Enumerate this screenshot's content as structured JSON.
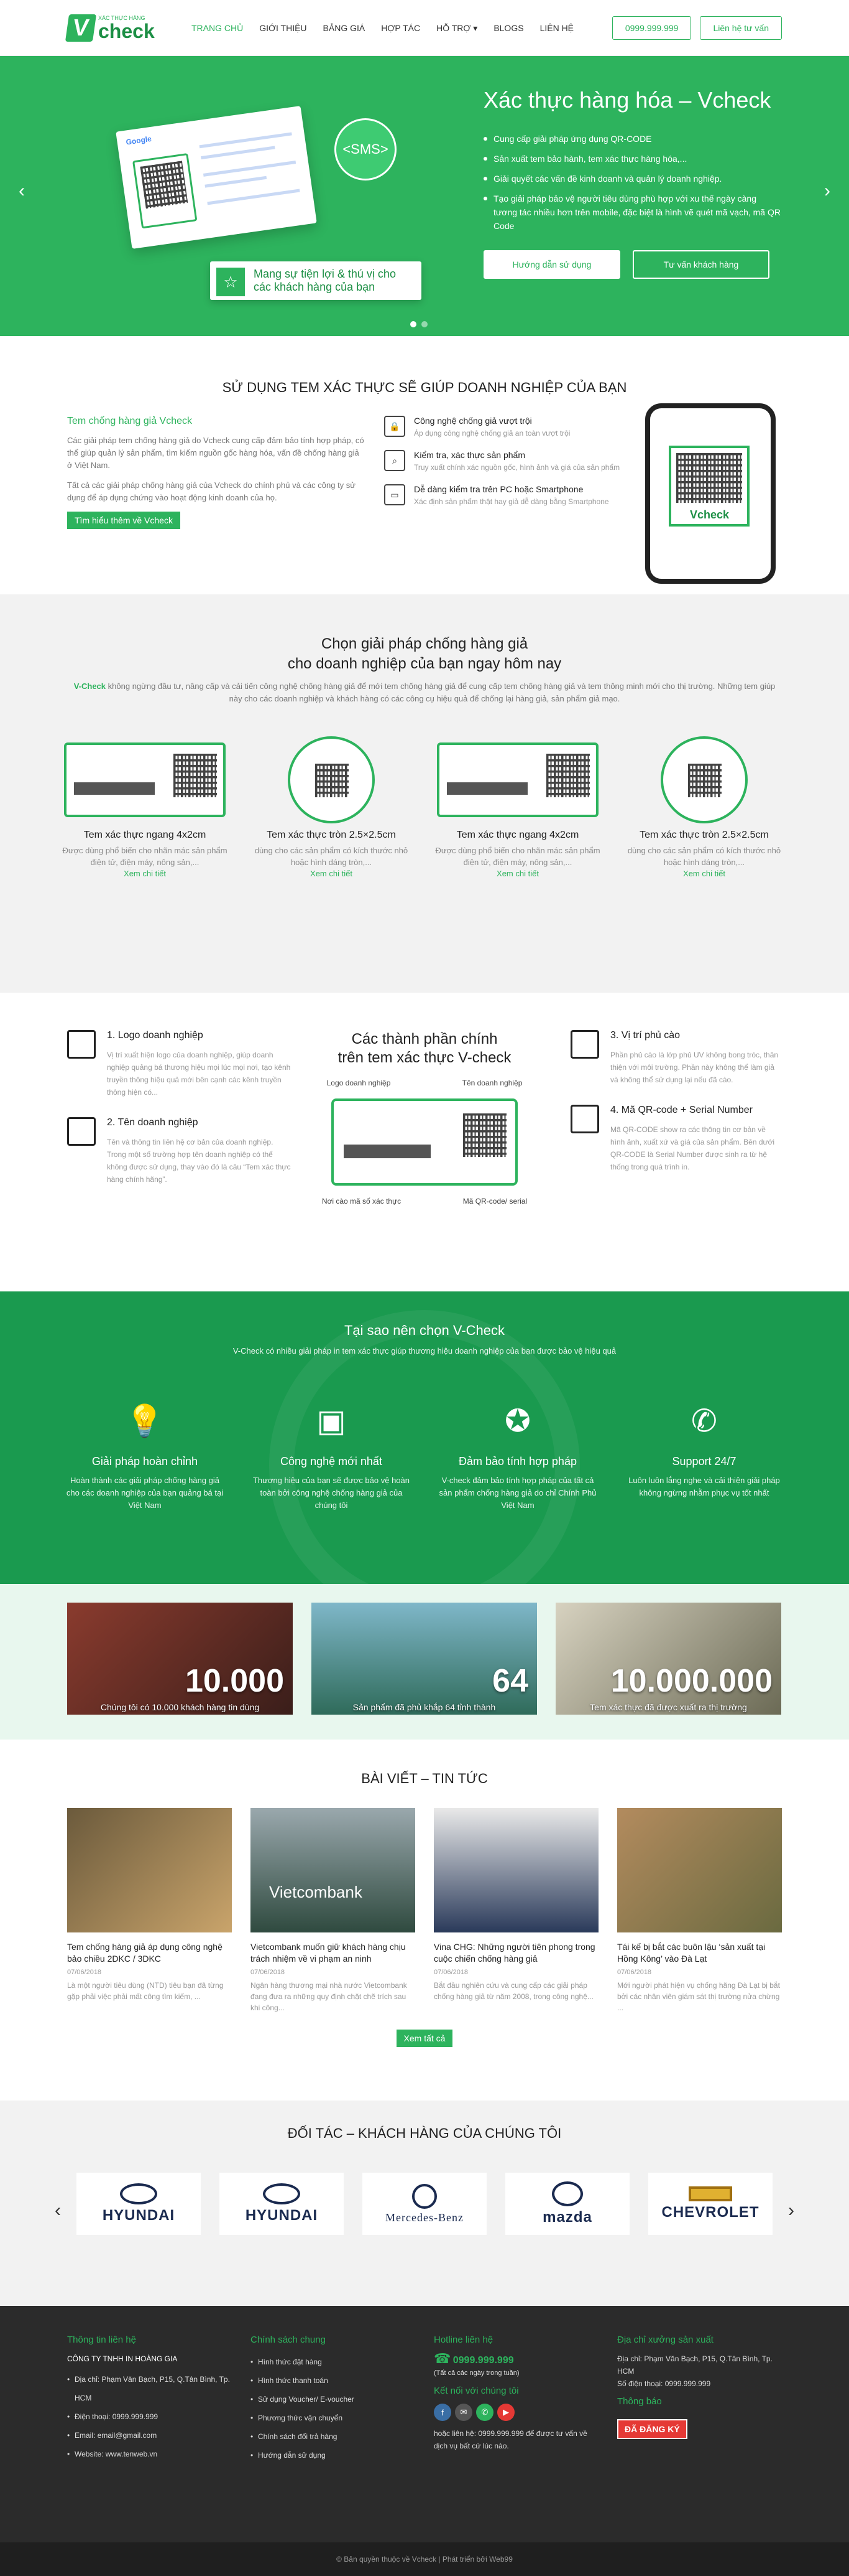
{
  "header": {
    "logo_small": "XÁC THỰC HÀNG",
    "logo_brand": "check",
    "logo_v": "V",
    "nav": [
      "TRANG CHỦ",
      "GIỚI THIỆU",
      "BẢNG GIÁ",
      "HỢP TÁC",
      "HỖ TRỢ",
      "BLOGS",
      "LIÊN HỆ"
    ],
    "phone": "0999.999.999",
    "consult": "Liên hệ tư vấn"
  },
  "hero": {
    "title": "Xác thực hàng hóa – Vcheck",
    "sms": "<SMS>",
    "google": "Google",
    "slogan": "Mang sự tiện lợi & thú vị cho các khách hàng của bạn",
    "bullets": [
      "Cung cấp giải pháp ứng dụng QR-CODE",
      "Sản xuất tem bảo hành, tem xác thực hàng hóa,...",
      "Giải quyết các vấn đề kinh doanh và quản lý doanh nghiệp.",
      "Tạo giải pháp bảo vệ người tiêu dùng phù hợp với xu thế ngày càng tương tác nhiều hơn trên mobile, đặc biệt là hình vẽ quét mã vạch, mã QR Code"
    ],
    "btn1": "Hướng dẫn sử dụng",
    "btn2": "Tư vấn khách hàng"
  },
  "benefits": {
    "title": "SỬ DỤNG TEM XÁC THỰC SẼ GIÚP DOANH NGHIỆP CỦA BẠN",
    "left_title": "Tem chống hàng giả Vcheck",
    "p1": "Các giải pháp tem chống hàng giả do Vcheck cung cấp đảm bảo tính hợp pháp, có thể giúp quản lý sản phẩm, tìm kiếm nguồn gốc hàng hóa, vấn đề chống hàng giả ở Việt Nam.",
    "p2": "Tất cả các giải pháp chống hàng giả của Vcheck do chính phủ và các công ty sử dụng để áp dụng chứng vào hoạt động kinh doanh của họ.",
    "btn": "Tìm hiểu thêm về Vcheck",
    "features": [
      {
        "t": "Công nghệ chống giả vượt trội",
        "d": "Áp dụng công nghệ chống giả an toàn vượt trội"
      },
      {
        "t": "Kiểm tra, xác thực sản phẩm",
        "d": "Truy xuất chính xác nguồn gốc, hình ảnh và giá của sản phẩm"
      },
      {
        "t": "Dễ dàng kiểm tra trên PC hoặc Smartphone",
        "d": "Xác định sản phẩm thật hay giả dễ dàng bằng Smartphone"
      }
    ],
    "phone_brand": "Vcheck"
  },
  "solutions": {
    "title1": "Chọn giải pháp chống hàng giả",
    "title2": "cho doanh nghiệp của bạn ngay hôm nay",
    "brand": "V-Check",
    "desc": "không ngừng đầu tư, nâng cấp và cải tiến công nghệ chống hàng giả để mới tem chống hàng giả để cung cấp tem chống hàng giả và tem thông minh mới cho thị trường. Những tem giúp này cho các doanh nghiệp và khách hàng có các công cụ hiệu quả để chống lại hàng giả, sản phẩm giả mạo.",
    "items": [
      {
        "t": "Tem xác thực ngang 4x2cm",
        "d": "Được dùng phổ biến cho nhãn mác sản phẩm điện tử, điện máy, nông sản,..."
      },
      {
        "t": "Tem xác thực tròn 2.5×2.5cm",
        "d": "dùng cho các sản phẩm có kích thước nhỏ hoặc hình dáng tròn,..."
      },
      {
        "t": "Tem xác thực ngang 4x2cm",
        "d": "Được dùng phổ biến cho nhãn mác sản phẩm điện tử, điện máy, nông sản,..."
      },
      {
        "t": "Tem xác thực tròn 2.5×2.5cm",
        "d": "dùng cho các sản phẩm có kích thước nhỏ hoặc hình dáng tròn,..."
      }
    ],
    "more": "Xem chi tiết"
  },
  "components": {
    "title1": "Các thành phần chính",
    "title2": "trên tem xác thực V-check",
    "tags": [
      "Logo doanh nghiệp",
      "Tên doanh nghiệp",
      "Nơi cào mã số xác thực",
      "Mã QR-code/ serial"
    ],
    "items": [
      {
        "t": "1. Logo doanh nghiệp",
        "d": "Vị trí xuất hiện logo của doanh nghiệp, giúp doanh nghiệp quảng bá thương hiệu mọi lúc mọi nơi, tạo kênh truyền thông hiệu quả mới bên cạnh các kênh truyền thông hiện có..."
      },
      {
        "t": "2. Tên doanh nghiệp",
        "d": "Tên và thông tin liên hệ cơ bản của doanh nghiệp. Trong một số trường hợp tên doanh nghiệp có thể không được sử dụng, thay vào đó là câu “Tem xác thực hàng chính hãng”."
      },
      {
        "t": "3. Vị trí phủ cào",
        "d": "Phần phủ cào là lớp phủ UV không bong tróc, thân thiện với môi trường. Phần này không thể làm giả và không thể sử dụng lại nếu đã cào."
      },
      {
        "t": "4. Mã QR-code + Serial Number",
        "d": "Mã QR-CODE show ra các thông tin cơ bản về hình ảnh, xuất xứ và giá của sản phẩm. Bên dưới QR-CODE là Serial Number được sinh ra từ hệ thống trong quá trình in."
      }
    ]
  },
  "why": {
    "title": "Tại sao nên chọn V-Check",
    "desc": "V-Check có nhiều giải pháp in tem xác thực giúp thương hiệu doanh nghiệp của bạn được bảo vệ hiệu quả",
    "items": [
      {
        "t": "Giải pháp hoàn chỉnh",
        "d": "Hoàn thành các giải pháp chống hàng giả cho các doanh nghiệp của bạn quảng bá tại Việt Nam"
      },
      {
        "t": "Công nghệ mới nhất",
        "d": "Thương hiệu của bạn sẽ được bảo vệ hoàn toàn bởi công nghệ chống hàng giả của chúng tôi"
      },
      {
        "t": "Đảm bảo tính hợp pháp",
        "d": "V-check đảm bảo tính hợp pháp của tất cả sản phẩm chống hàng giả do chỉ Chính Phủ Việt Nam"
      },
      {
        "t": "Support 24/7",
        "d": "Luôn luôn lắng nghe và cải thiện giải pháp không ngừng nhằm phục vụ tốt nhất"
      }
    ]
  },
  "stats": [
    {
      "n": "10.000",
      "t": "Chúng tôi có 10.000 khách hàng tin dùng"
    },
    {
      "n": "64",
      "t": "Sản phẩm đã phủ khắp 64 tỉnh thành"
    },
    {
      "n": "10.000.000",
      "t": "Tem xác thực đã được xuất ra thị trường"
    }
  ],
  "news": {
    "title": "BÀI VIẾT – TIN TỨC",
    "more": "Xem tất cả",
    "items": [
      {
        "t": "Tem chống hàng giả áp dụng công nghệ bảo chiều 2DKC / 3DKC",
        "dt": "07/06/2018",
        "d": "Là một người tiêu dùng (NTD) tiêu bạn đã từng gặp phải việc phải mất công tìm kiếm, ..."
      },
      {
        "t": "Vietcombank muốn giữ khách hàng chịu trách nhiệm về vi phạm an ninh",
        "dt": "07/06/2018",
        "d": "Ngân hàng thương mại nhà nước Vietcombank đang đưa ra những quy định chặt chẽ trích sau khi công..."
      },
      {
        "t": "Vina CHG: Những người tiên phong trong cuộc chiến chống hàng giả",
        "dt": "07/06/2018",
        "d": "Bắt đầu nghiên cứu và cung cấp các giải pháp chống hàng giả từ năm 2008, trong công nghệ..."
      },
      {
        "t": "Tái kế bị bắt các buôn lậu ‘sản xuất tại Hồng Kông’ vào Đà Lạt",
        "dt": "07/06/2018",
        "d": "Mới người phát hiện vụ chống hãng Đà Lạt bị bắt bởi các nhân viên giám sát thị trường nửa chừng ..."
      }
    ],
    "bank": "Vietcombank"
  },
  "partners": {
    "title": "ĐỐI TÁC – KHÁCH HÀNG CỦA CHÚNG TÔI",
    "logos": [
      "HYUNDAI",
      "HYUNDAI",
      "Mercedes-Benz",
      "mazda",
      "CHEVROLET"
    ]
  },
  "footer": {
    "c1_title": "Thông tin liên hệ",
    "company": "CÔNG TY TNHH IN HOÀNG GIA",
    "c1": [
      "Địa chỉ: Phạm Văn Bạch, P15, Q.Tân Bình, Tp. HCM",
      "Điện thoại: 0999.999.999",
      "Email: email@gmail.com",
      "Website: www.tenweb.vn"
    ],
    "c2_title": "Chính sách chung",
    "c2": [
      "Hình thức đặt hàng",
      "Hình thức thanh toán",
      "Sử dụng Voucher/ E-voucher",
      "Phương thức vận chuyển",
      "Chính sách đổi trả hàng",
      "Hướng dẫn sử dụng"
    ],
    "c3_title": "Hotline liên hệ",
    "hotline": "0999.999.999",
    "hotline_note": "(Tất cả các ngày trong tuần)",
    "social_title": "Kết nối với chúng tôi",
    "social": [
      "f",
      "✉",
      "✆",
      "▶"
    ],
    "c3_note": "hoặc liên hệ: 0999.999.999 để được tư vấn về dịch vụ bất cứ lúc nào.",
    "c4_title": "Địa chỉ xưởng sản xuất",
    "c4": [
      "Địa chỉ: Phạm Văn Bạch, P15, Q.Tân Bình, Tp. HCM",
      "Số điện thoại: 0999.999.999"
    ],
    "notice": "Thông báo",
    "badge": "ĐÃ ĐĂNG KÝ",
    "copy": "© Bản quyền thuộc về Vcheck | Phát triển bởi Web99"
  },
  "colors": {
    "green": "#2db35d",
    "dark_green": "#1a9a4f",
    "footer": "#2b2b2b"
  }
}
